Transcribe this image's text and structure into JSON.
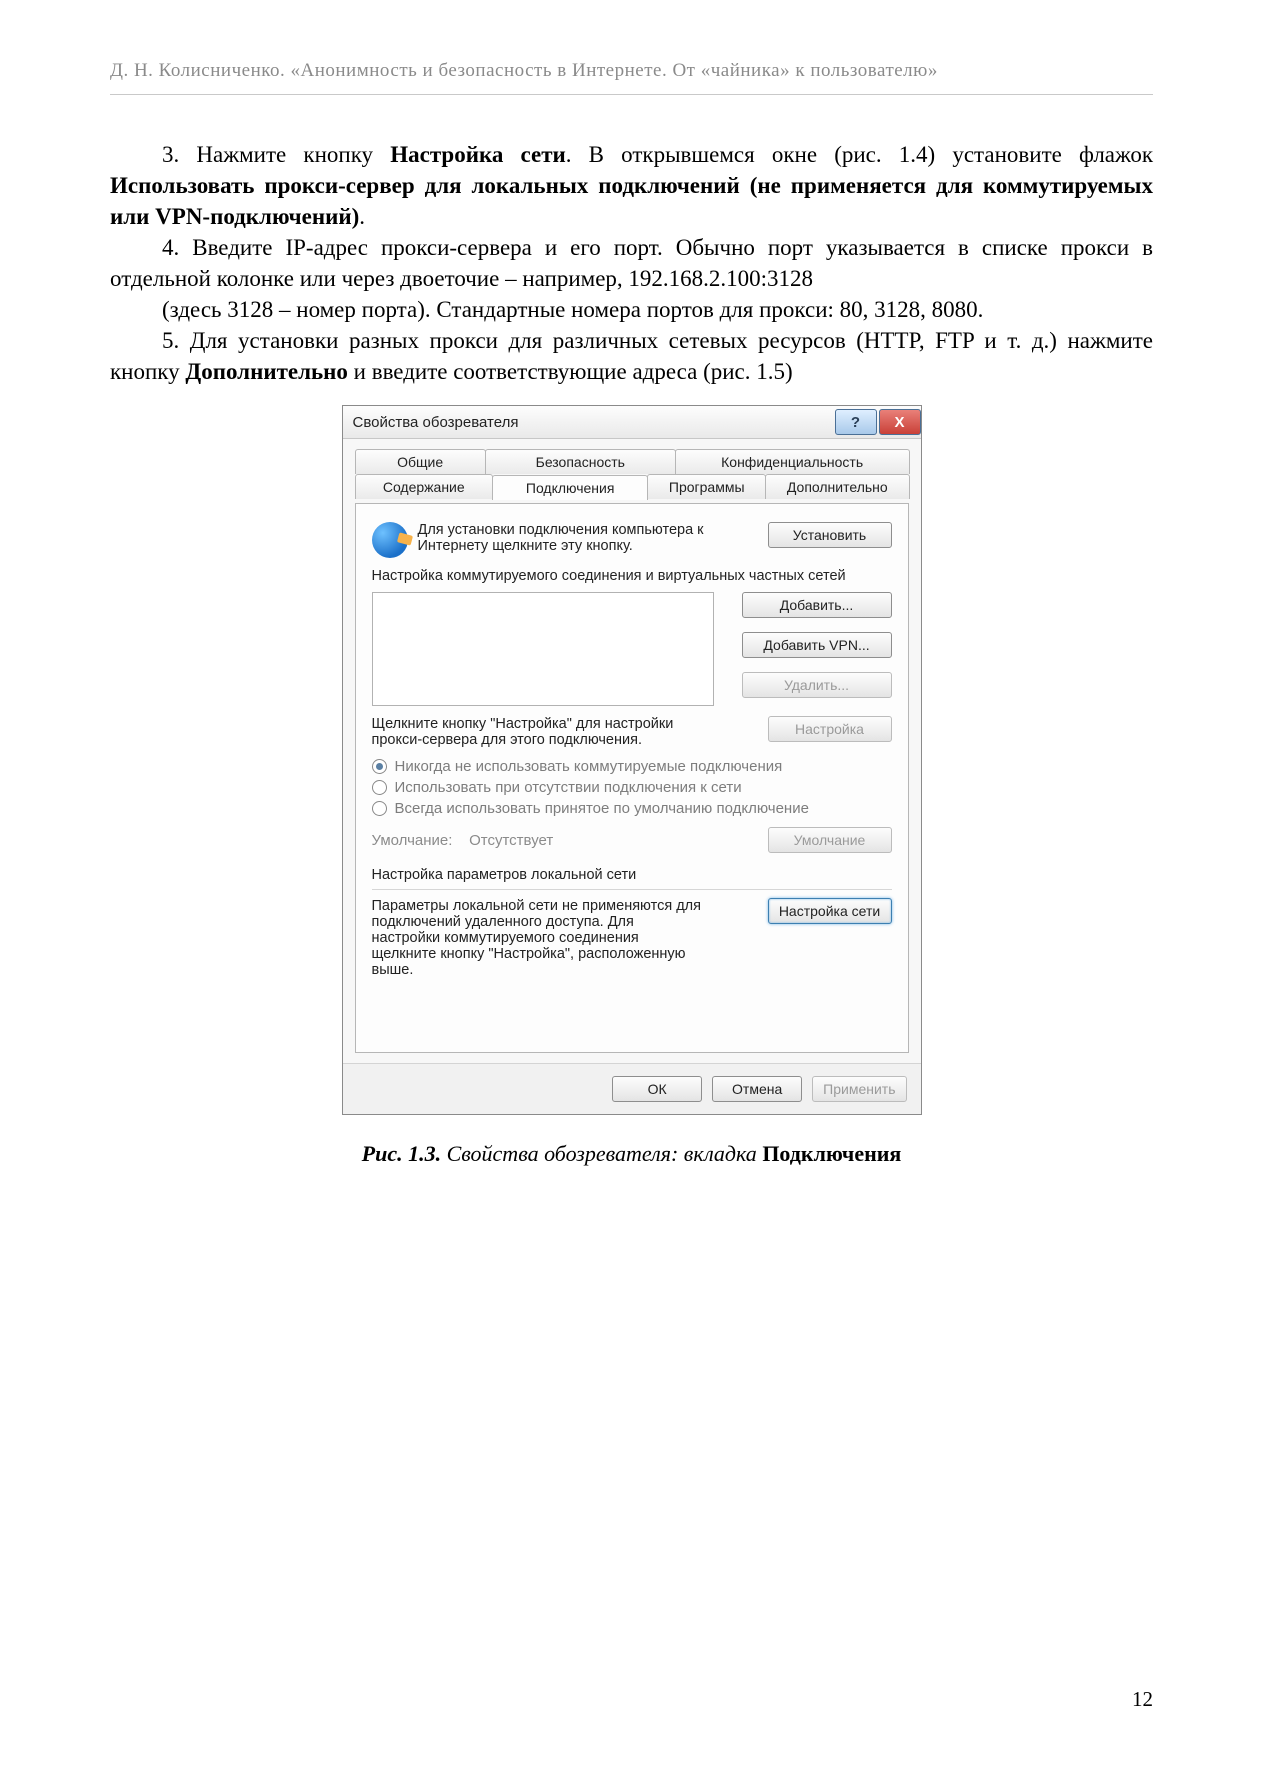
{
  "header": "Д.  Н.  Колисниченко.  «Анонимность и безопасность в Интернете. От «чайника» к пользователю»",
  "para1": {
    "pre": "3. Нажмите кнопку ",
    "b1": "Настройка сети",
    "mid": ". В открывшемся окне (рис. 1.4) установите фла­жок ",
    "b2": "Использовать прокси-сервер для локальных подключений (не применяется для коммутируемых или VPN-подключений)",
    "post": "."
  },
  "para2": "4. Введите IP-адрес прокси-сервера и его порт. Обычно порт указывается в списке прокси в отдельной колонке или через двоеточие – например, 192.168.2.100:3128",
  "para3": "(здесь 3128 – номер порта). Стандартные номера портов для прокси: 80, 3128, 8080.",
  "para4": {
    "pre": "5. Для установки разных прокси для различных сетевых ресурсов (HTTP, FTP и т. д.) нажмите кнопку ",
    "b1": "Дополнительно",
    "post": " и введите соответствующие адреса (рис. 1.5)"
  },
  "dialog": {
    "title": "Свойства обозревателя",
    "help_glyph": "?",
    "close_glyph": "X",
    "tabs_row1": [
      "Общие",
      "Безопасность",
      "Конфиденциальность"
    ],
    "tabs_row2": [
      "Содержание",
      "Подключения",
      "Программы",
      "Дополнительно"
    ],
    "active_tab": "Подключения",
    "setup_text": "Для установки подключения компьютера к Интернету щелкните эту кнопку.",
    "btn_install": "Установить",
    "dialup_title": "Настройка коммутируемого соединения и виртуальных частных сетей",
    "btn_add": "Добавить...",
    "btn_add_vpn": "Добавить VPN...",
    "btn_delete": "Удалить...",
    "settings_text": "Щелкните кнопку \"Настройка\" для настройки прокси-сервера для этого подключения.",
    "btn_settings": "Настройка",
    "radio1": "Никогда не использовать коммутируемые подключения",
    "radio2": "Использовать при отсутствии подключения к сети",
    "radio3": "Всегда использовать принятое по умолчанию подключение",
    "default_label": "Умолчание:",
    "default_value": "Отсутствует",
    "btn_default": "Умолчание",
    "lan_title": "Настройка параметров локальной сети",
    "lan_text": "Параметры локальной сети не применяются для подключений удаленного доступа. Для настройки коммутируемого соединения щелкните кнопку \"Настройка\", расположенную выше.",
    "btn_lan": "Настройка сети",
    "btn_ok": "ОК",
    "btn_cancel": "Отмена",
    "btn_apply": "Применить"
  },
  "caption": {
    "num": "Рис. 1.3.",
    "text": " Свойства обозревателя: вкладка ",
    "bold": "Подключения"
  },
  "page_number": "12"
}
